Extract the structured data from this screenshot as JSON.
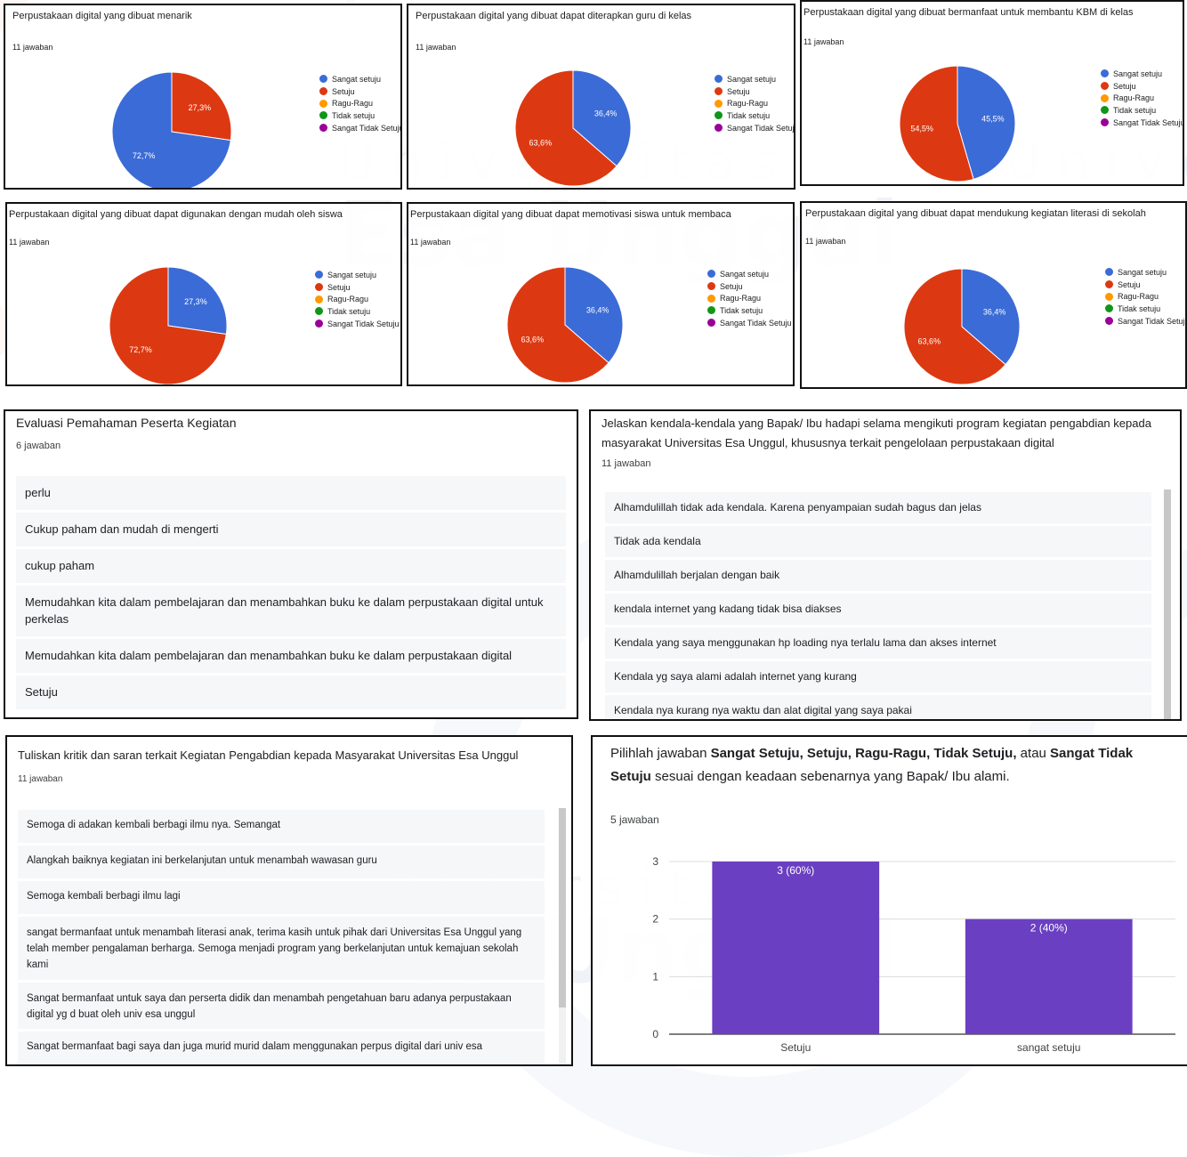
{
  "watermark": {
    "line1": "Universitas",
    "line2": "Esa Unggul"
  },
  "palette": {
    "sangat_setuju": "#3b6bd6",
    "setuju": "#dc3912",
    "ragu": "#ff9900",
    "tidak_setuju": "#109618",
    "sangat_tidak_setuju": "#990099",
    "bar": "#6a3fc2"
  },
  "legend_labels": [
    "Sangat setuju",
    "Setuju",
    "Ragu-Ragu",
    "Tidak setuju",
    "Sangat Tidak Setuju"
  ],
  "pies": [
    {
      "title": "Perpustakaan digital yang dibuat menarik",
      "count": "11 jawaban",
      "slices": [
        {
          "label": "Sangat setuju",
          "value": 72.7,
          "text": "72,7%"
        },
        {
          "label": "Setuju",
          "value": 27.3,
          "text": "27,3%"
        }
      ]
    },
    {
      "title": "Perpustakaan digital yang dibuat dapat diterapkan guru di kelas",
      "count": "11 jawaban",
      "slices": [
        {
          "label": "Sangat setuju",
          "value": 36.4,
          "text": "36,4%"
        },
        {
          "label": "Setuju",
          "value": 63.6,
          "text": "63,6%"
        }
      ]
    },
    {
      "title": "Perpustakaan digital yang dibuat bermanfaat untuk membantu KBM di kelas",
      "count": "11 jawaban",
      "slices": [
        {
          "label": "Sangat setuju",
          "value": 45.5,
          "text": "45,5%"
        },
        {
          "label": "Setuju",
          "value": 54.5,
          "text": "54,5%"
        }
      ]
    },
    {
      "title": "Perpustakaan digital yang dibuat dapat digunakan dengan mudah oleh siswa",
      "count": "11 jawaban",
      "slices": [
        {
          "label": "Sangat setuju",
          "value": 27.3,
          "text": "27,3%"
        },
        {
          "label": "Setuju",
          "value": 72.7,
          "text": "72,7%"
        }
      ]
    },
    {
      "title": "Perpustakaan digital yang dibuat dapat memotivasi siswa untuk membaca",
      "count": "11 jawaban",
      "slices": [
        {
          "label": "Sangat setuju",
          "value": 36.4,
          "text": "36,4%"
        },
        {
          "label": "Setuju",
          "value": 63.6,
          "text": "63,6%"
        }
      ]
    },
    {
      "title": "Perpustakaan digital yang dibuat dapat mendukung kegiatan literasi di sekolah",
      "count": "11 jawaban",
      "slices": [
        {
          "label": "Sangat setuju",
          "value": 36.4,
          "text": "36,4%"
        },
        {
          "label": "Setuju",
          "value": 63.6,
          "text": "63,6%"
        }
      ]
    }
  ],
  "evaluasi": {
    "title": "Evaluasi Pemahaman Peserta Kegiatan",
    "count": "6 jawaban",
    "responses": [
      "perlu",
      "Cukup paham dan mudah di mengerti",
      "cukup paham",
      "Memudahkan kita dalam pembelajaran dan menambahkan buku ke dalam perpustakaan digital untuk perkelas",
      "Memudahkan kita dalam pembelajaran dan menambahkan buku ke dalam perpustakaan digital",
      "Setuju"
    ]
  },
  "kendala": {
    "title": "Jelaskan kendala-kendala yang Bapak/ Ibu hadapi selama mengikuti program kegiatan pengabdian kepada masyarakat Universitas Esa Unggul, khususnya terkait pengelolaan perpustakaan digital",
    "count": "11 jawaban",
    "responses": [
      "Alhamdulillah tidak ada kendala. Karena penyampaian sudah bagus dan jelas",
      "Tidak ada kendala",
      "Alhamdulillah berjalan dengan baik",
      "kendala internet yang kadang tidak bisa diakses",
      "Kendala yang saya menggunakan hp loading nya terlalu lama dan akses internet",
      "Kendala yg saya alami adalah internet yang kurang",
      "Kendala nya kurang nya waktu dan alat digital yang saya pakai"
    ]
  },
  "kritik": {
    "title": "Tuliskan kritik dan saran terkait Kegiatan Pengabdian kepada Masyarakat Universitas Esa Unggul",
    "count": "11 jawaban",
    "responses": [
      "Semoga di adakan kembali berbagi ilmu nya. Semangat",
      "Alangkah baiknya kegiatan ini berkelanjutan untuk menambah wawasan guru",
      "Semoga kembali berbagi ilmu lagi",
      "sangat bermanfaat untuk menambah literasi anak, terima kasih untuk pihak dari Universitas Esa Unggul yang telah member pengalaman berharga. Semoga menjadi program yang berkelanjutan untuk kemajuan sekolah kami",
      "Sangat bermanfaat untuk saya dan perserta didik dan menambah pengetahuan baru adanya perpustakaan digital yg d buat oleh univ esa unggul",
      "Sangat bermanfaat bagi saya dan juga murid murid dalam menggunakan perpus digital dari univ esa"
    ]
  },
  "bar_question": {
    "title_parts": [
      {
        "t": "Pilihlah jawaban ",
        "b": false
      },
      {
        "t": "Sangat Setuju, Setuju, Ragu-Ragu, Tidak Setuju,",
        "b": true
      },
      {
        "t": " atau ",
        "b": false
      },
      {
        "t": "Sangat Tidak Setuju",
        "b": true
      },
      {
        "t": " sesuai dengan keadaan sebenarnya yang Bapak/ Ibu alami.",
        "b": false
      }
    ],
    "count": "5 jawaban"
  },
  "chart_data": {
    "type": "bar",
    "categories": [
      "Setuju",
      "sangat setuju"
    ],
    "values": [
      3,
      2
    ],
    "data_labels": [
      "3 (60%)",
      "2 (40%)"
    ],
    "yticks": [
      0,
      1,
      2,
      3
    ],
    "ylim": [
      0,
      3
    ],
    "grid": true
  }
}
